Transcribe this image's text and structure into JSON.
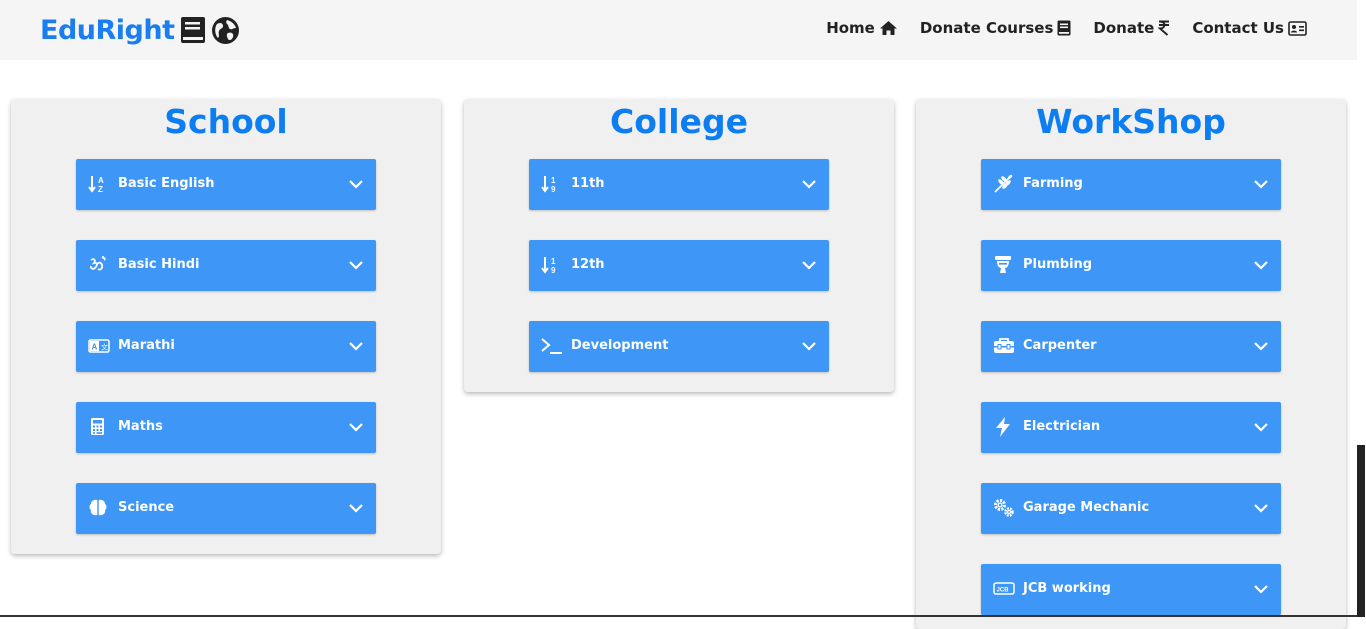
{
  "brand": {
    "name": "EduRight",
    "color": "#1a7ef0"
  },
  "nav": {
    "home": "Home",
    "donate_courses": "Donate Courses",
    "donate": "Donate",
    "contact": "Contact Us"
  },
  "colors": {
    "accent": "#0d7ef2",
    "item_bg": "#3e96f7",
    "card_bg": "#f0f0f0",
    "navbar_bg": "#f5f5f5"
  },
  "sections": {
    "school": {
      "title": "School",
      "items": [
        {
          "label": "Basic English",
          "icon": "sort-az-icon"
        },
        {
          "label": "Basic Hindi",
          "icon": "om-icon"
        },
        {
          "label": "Marathi",
          "icon": "language-icon"
        },
        {
          "label": "Maths",
          "icon": "calculator-icon"
        },
        {
          "label": "Science",
          "icon": "brain-icon"
        }
      ]
    },
    "college": {
      "title": "College",
      "items": [
        {
          "label": "11th",
          "icon": "sort-numeric-icon"
        },
        {
          "label": "12th",
          "icon": "sort-numeric-icon"
        },
        {
          "label": "Development",
          "icon": "terminal-icon"
        }
      ]
    },
    "workshop": {
      "title": "WorkShop",
      "items": [
        {
          "label": "Farming",
          "icon": "wheat-icon"
        },
        {
          "label": "Plumbing",
          "icon": "toilet-icon"
        },
        {
          "label": "Carpenter",
          "icon": "toolbox-icon"
        },
        {
          "label": "Electrician",
          "icon": "bolt-icon"
        },
        {
          "label": "Garage Mechanic",
          "icon": "gears-icon"
        },
        {
          "label": "JCB working",
          "icon": "jcb-icon"
        }
      ]
    }
  }
}
